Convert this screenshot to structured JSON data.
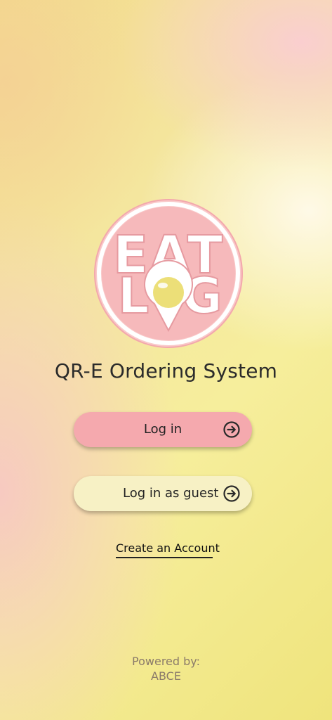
{
  "logo": {
    "line1": "EAT",
    "line2a": "L",
    "line2b": "G",
    "colors": {
      "badge": "#f6b9bb",
      "ring": "#ffffff",
      "yolk": "#ecdf78"
    }
  },
  "app": {
    "title": "QR-E Ordering System"
  },
  "buttons": {
    "login_label": "Log in",
    "guest_label": "Log in as guest",
    "arrow_icon": "arrow-circle-right-icon"
  },
  "links": {
    "create_account": "Create an Account"
  },
  "footer": {
    "powered_by": "Powered by:",
    "company": "ABCE"
  },
  "colors": {
    "login_button": "#f5a9ae",
    "guest_button": "#f7f1c5",
    "background_yellow": "#f3e68a",
    "background_pink": "#f7c8c3"
  }
}
